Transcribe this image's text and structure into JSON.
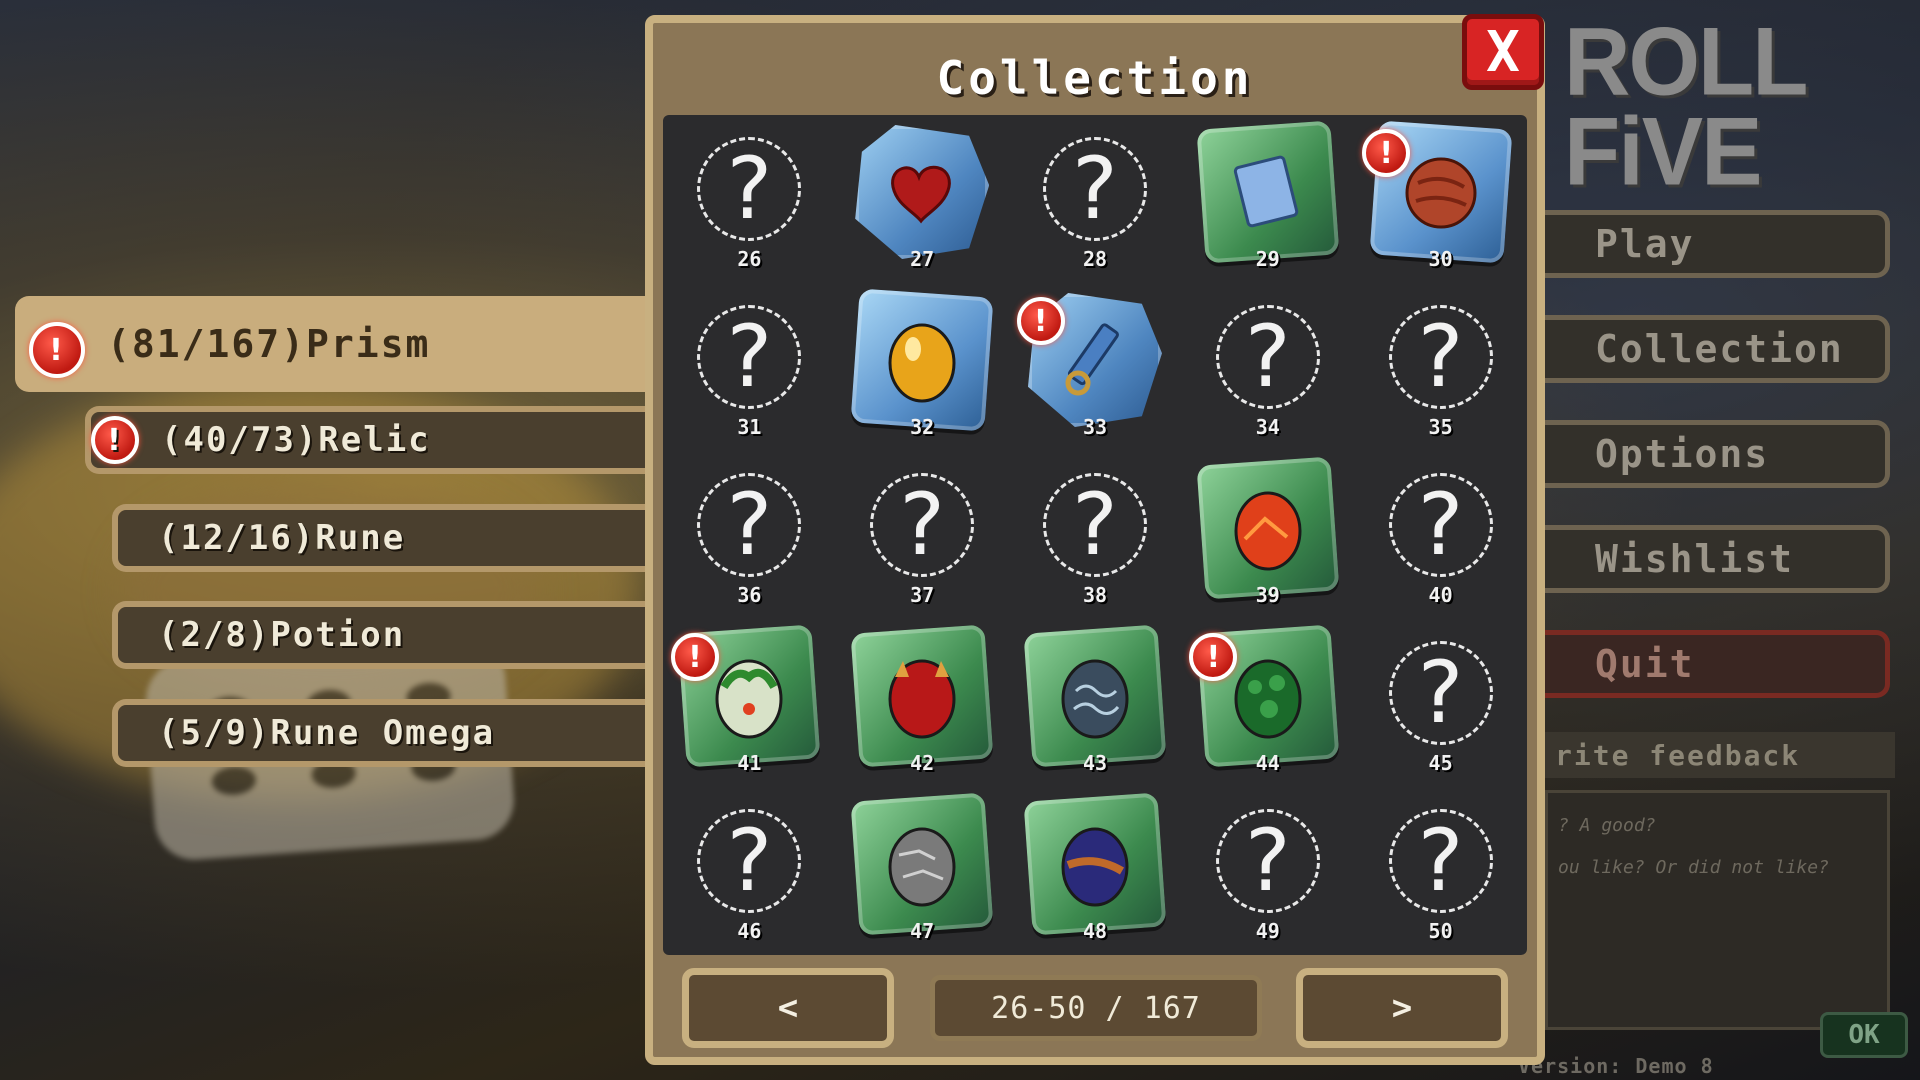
{
  "panel": {
    "title": "Collection",
    "close_label": "X"
  },
  "categories": [
    {
      "label": "(81/167)Prism",
      "alert": true,
      "active": true
    },
    {
      "label": "(40/73)Relic",
      "alert": true,
      "active": false
    },
    {
      "label": "(12/16)Rune",
      "alert": false,
      "active": false
    },
    {
      "label": "(2/8)Potion",
      "alert": false,
      "active": false
    },
    {
      "label": "(5/9)Rune Omega",
      "alert": false,
      "active": false
    }
  ],
  "items": [
    {
      "num": "26",
      "state": "unknown"
    },
    {
      "num": "27",
      "state": "owned",
      "frame": "blue",
      "icon": "heart-icon"
    },
    {
      "num": "28",
      "state": "unknown"
    },
    {
      "num": "29",
      "state": "owned",
      "frame": "green",
      "icon": "book-icon"
    },
    {
      "num": "30",
      "state": "owned",
      "frame": "bluecube",
      "icon": "orb-icon",
      "alert": true
    },
    {
      "num": "31",
      "state": "unknown"
    },
    {
      "num": "32",
      "state": "owned",
      "frame": "bluecube",
      "icon": "golden-egg-icon"
    },
    {
      "num": "33",
      "state": "owned",
      "frame": "blue",
      "icon": "saw-icon",
      "alert": true
    },
    {
      "num": "34",
      "state": "unknown"
    },
    {
      "num": "35",
      "state": "unknown"
    },
    {
      "num": "36",
      "state": "unknown"
    },
    {
      "num": "37",
      "state": "unknown"
    },
    {
      "num": "38",
      "state": "unknown"
    },
    {
      "num": "39",
      "state": "owned",
      "frame": "green",
      "icon": "fire-egg-icon"
    },
    {
      "num": "40",
      "state": "unknown"
    },
    {
      "num": "41",
      "state": "owned",
      "frame": "green",
      "icon": "nature-egg-icon",
      "alert": true
    },
    {
      "num": "42",
      "state": "owned",
      "frame": "green",
      "icon": "demon-egg-icon"
    },
    {
      "num": "43",
      "state": "owned",
      "frame": "green",
      "icon": "swirl-egg-icon"
    },
    {
      "num": "44",
      "state": "owned",
      "frame": "green",
      "icon": "bumpy-egg-icon",
      "alert": true
    },
    {
      "num": "45",
      "state": "unknown"
    },
    {
      "num": "46",
      "state": "unknown"
    },
    {
      "num": "47",
      "state": "owned",
      "frame": "green",
      "icon": "stone-egg-icon"
    },
    {
      "num": "48",
      "state": "owned",
      "frame": "green",
      "icon": "galaxy-egg-icon"
    },
    {
      "num": "49",
      "state": "unknown"
    },
    {
      "num": "50",
      "state": "unknown"
    }
  ],
  "unknown_glyph": "?",
  "alert_glyph": "!",
  "pager": {
    "prev_label": "<",
    "next_label": ">",
    "page_indicator": "26-50 / 167"
  },
  "logo": {
    "line1": "ROLL",
    "line2": "FiVE"
  },
  "menu": [
    {
      "label": "Play"
    },
    {
      "label": "Collection"
    },
    {
      "label": "Options"
    },
    {
      "label": "Wishlist"
    },
    {
      "label": "Quit"
    }
  ],
  "feedback": {
    "title": "rite feedback",
    "line1": "? A good?",
    "line2": "ou like? Or did not like?",
    "ok_label": "OK"
  },
  "version": "Version: Demo 8"
}
